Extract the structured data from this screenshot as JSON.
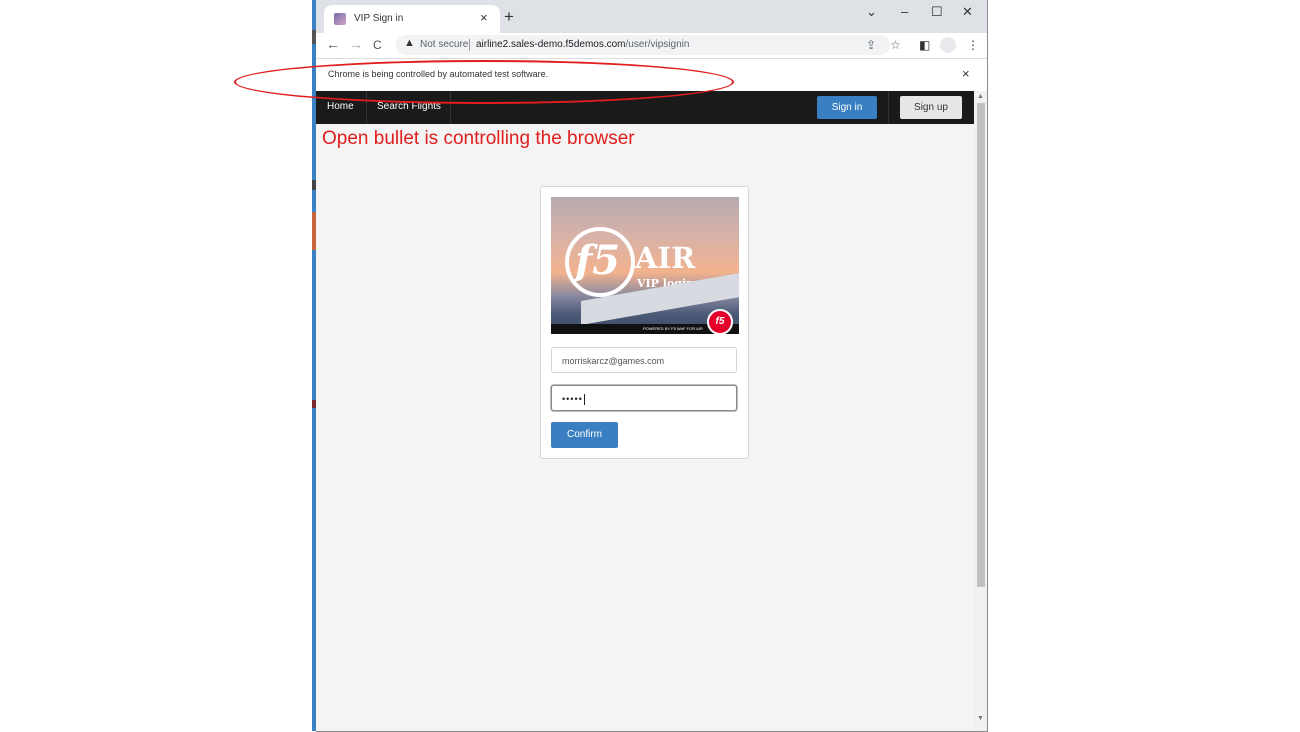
{
  "browser": {
    "tab_title": "VIP Sign in",
    "new_tab_glyph": "+",
    "tab_close_glyph": "×",
    "window_controls": {
      "list": "⌄",
      "minimize": "–",
      "maximize": "☐",
      "close": "✕"
    },
    "nav": {
      "back": "←",
      "forward": "→",
      "reload": "C"
    },
    "not_secure_label": "Not secure",
    "url_host": "airline2.sales-demo.f5demos.com",
    "url_path": "/user/vipsignin",
    "toolbar_icons": [
      "share-icon",
      "star-icon",
      "side-panel-icon",
      "profile-icon",
      "menu-icon"
    ],
    "infobar_text": "Chrome is being controlled by automated test software.",
    "infobar_close": "×"
  },
  "site": {
    "nav_items": [
      "Home",
      "Search Flights"
    ],
    "signin_label": "Sign in",
    "signup_label": "Sign up"
  },
  "annotation": {
    "text": "Open bullet is controlling the browser",
    "color": "#e11d1d"
  },
  "login": {
    "logo_f5": "f5",
    "logo_air": "AIR",
    "logo_subtitle": "VIP login",
    "logo_powered": "POWERED BY F5 WAF FOR AIR",
    "badge_text": "f5",
    "email_value": "morriskarcz@games.com",
    "password_value": "•••••",
    "confirm_label": "Confirm"
  },
  "colors": {
    "primary_button": "#3a7fc1",
    "nav_bg": "#1a1a1a",
    "annotation_red": "#e11d1d"
  }
}
